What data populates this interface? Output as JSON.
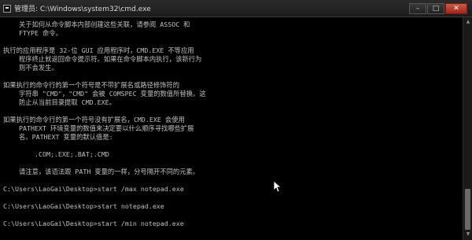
{
  "window": {
    "title": "管理员: C:\\Windows\\system32\\cmd.exe",
    "controls": [
      "–",
      "□",
      "✕"
    ]
  },
  "console": {
    "lines": [
      "    关于如何从命令脚本内部创建这些关联，请参阅 ASSOC 和",
      "    FTYPE 命令。",
      "",
      "执行的应用程序是 32-位 GUI 应用程序时，CMD.EXE 不等应用",
      "    程序终止就返回命令提示符。如果在命令脚本内执行，该新行为",
      "    则不会发生。",
      "",
      "如果执行的命令行的第一个符号是不带扩展名或路径修饰符的",
      "    字符串 \"CMD\"，\"CMD\" 会被 COMSPEC 变量的数值所替换。这",
      "    防止从当前目录提取 CMD.EXE。",
      "",
      "如果执行的命令行的第一个符号没有扩展名，CMD.EXE 会使用",
      "    PATHEXT 环境变量的数值来决定要以什么顺序寻找哪些扩展",
      "    名。PATHEXT 变量的默认值是:",
      "",
      "        .COM;.EXE;.BAT;.CMD",
      "",
      "    请注意，该语法跟 PATH 变量的一样，分号隔开不同的元素。",
      "",
      "C:\\Users\\LaoGai\\Desktop>start /max notepad.exe",
      "",
      "C:\\Users\\LaoGai\\Desktop>start notepad.exe",
      "",
      "C:\\Users\\LaoGai\\Desktop>start /min notepad.exe"
    ]
  },
  "colors": {
    "text": "#c0c0c0",
    "background": "#000000"
  }
}
